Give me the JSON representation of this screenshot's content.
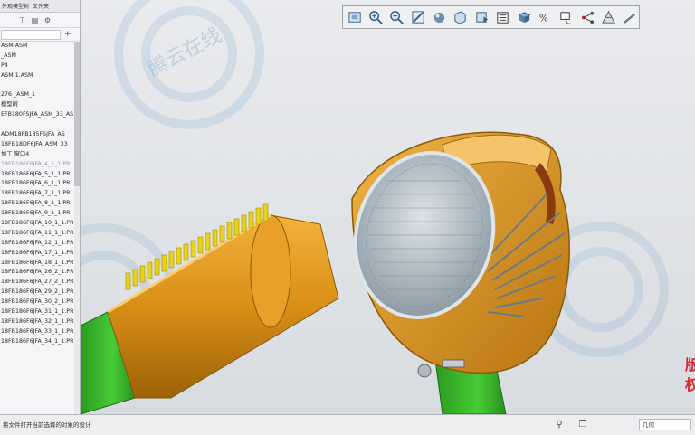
{
  "panel": {
    "tabs": [
      "外观模型树",
      "文件夹"
    ],
    "tree_items": [
      "ASM.ASM",
      "_ASM",
      "P4",
      "ASM 1.ASM",
      "",
      "276 _ASM_1",
      "模型树",
      "EFB180FSJFA_ASM_33_AS",
      "",
      "ADM18FB185FSJFA_AS",
      "18FB18DF6JFA_ASM_33",
      "加工 窗口4",
      "18FB186F6JFA_4_1_1.PR",
      "18FB186F6JFA_5_1_1.PR",
      "18FB186F6JFA_6_1_1.PR",
      "18FB186F6JFA_7_1_1.PR",
      "18FB186F6JFA_8_1_1.PR",
      "18FB186F6JFA_9_1_1.PR",
      "18FB186F6JFA_10_1_1.PR",
      "18FB186F6JFA_11_1_1.PR",
      "18FB186F6JFA_12_1_1.PR",
      "18FB186F6JFA_17_1_1.PR",
      "18FB186F6JFA_18_1_1.PR",
      "18FB186F6JFA_26_2_1.PR",
      "18FB186F6JFA_27_2_1.PR",
      "18FB186F6JFA_29_2_1.PR",
      "18FB186F6JFA_30_2_1.PR",
      "18FB186F6JFA_31_1_1.PR",
      "18FB186F6JFA_32_1_1.PR",
      "18FB186F6JFA_33_1_1.PR",
      "18FB186F6JFA_34_1_1.PR"
    ]
  },
  "toolbar_icons": [
    "refit-icon",
    "zoom-in-icon",
    "zoom-out-icon",
    "repaint-icon",
    "shading-icon",
    "perspective-icon",
    "saved-views-icon",
    "layers-icon",
    "display-style-icon",
    "datum-display-icon",
    "annotation-icon",
    "spin-center-icon",
    "section-icon",
    "more-icon"
  ],
  "status": {
    "message": "将文件打开当前选择的对象的设计",
    "filter_value": "几何"
  },
  "watermark": {
    "text": "腾云在线",
    "overlay_chars": [
      "版",
      "权"
    ]
  },
  "colors": {
    "housing_orange": "#e69a1a",
    "handle_green": "#35bb26",
    "teeth_yellow": "#e8d21a",
    "grille_silver": "#b9c4cc",
    "panel_bg": "#f4f5f7"
  }
}
